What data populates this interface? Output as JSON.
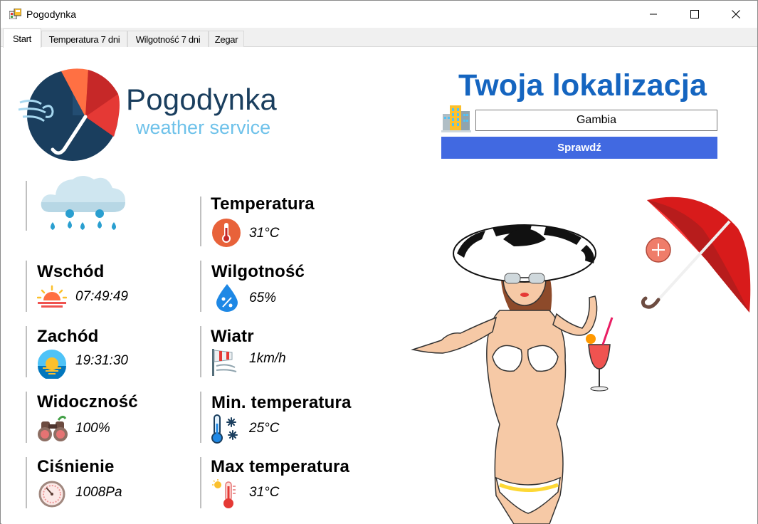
{
  "window": {
    "title": "Pogodynka"
  },
  "tabs": [
    {
      "label": "Start",
      "active": true
    },
    {
      "label": "Temperatura 7 dni",
      "active": false
    },
    {
      "label": "Wilgotność 7 dni",
      "active": false
    },
    {
      "label": "Zegar",
      "active": false
    }
  ],
  "brand": {
    "name": "Pogodynka",
    "tagline": "weather service"
  },
  "location": {
    "title": "Twoja lokalizacja",
    "value": "Gambia",
    "button": "Sprawdź"
  },
  "weather_icon": "rain-cloud-icon",
  "left_stats": [
    {
      "label": "Wschód",
      "value": "07:49:49",
      "icon": "sunrise-icon"
    },
    {
      "label": "Zachód",
      "value": "19:31:30",
      "icon": "sunset-icon"
    },
    {
      "label": "Widoczność",
      "value": "100%",
      "icon": "binoculars-icon"
    },
    {
      "label": "Ciśnienie",
      "value": "1008Pa",
      "icon": "barometer-icon"
    }
  ],
  "right_stats": [
    {
      "label": "Temperatura",
      "value": "31°C",
      "icon": "thermometer-icon"
    },
    {
      "label": "Wilgotność",
      "value": "65%",
      "icon": "humidity-drop-icon"
    },
    {
      "label": "Wiatr",
      "value": "1km/h",
      "icon": "wind-sock-icon"
    },
    {
      "label": "Min. temperatura",
      "value": "25°C",
      "icon": "cold-thermometer-icon"
    },
    {
      "label": "Max temperatura",
      "value": "31°C",
      "icon": "hot-thermometer-icon"
    }
  ],
  "colors": {
    "accent": "#1565c0",
    "button": "#4169e1",
    "brand_dark": "#1a3e5e",
    "brand_light": "#6fc2ea",
    "umbrella": "#e02020"
  }
}
